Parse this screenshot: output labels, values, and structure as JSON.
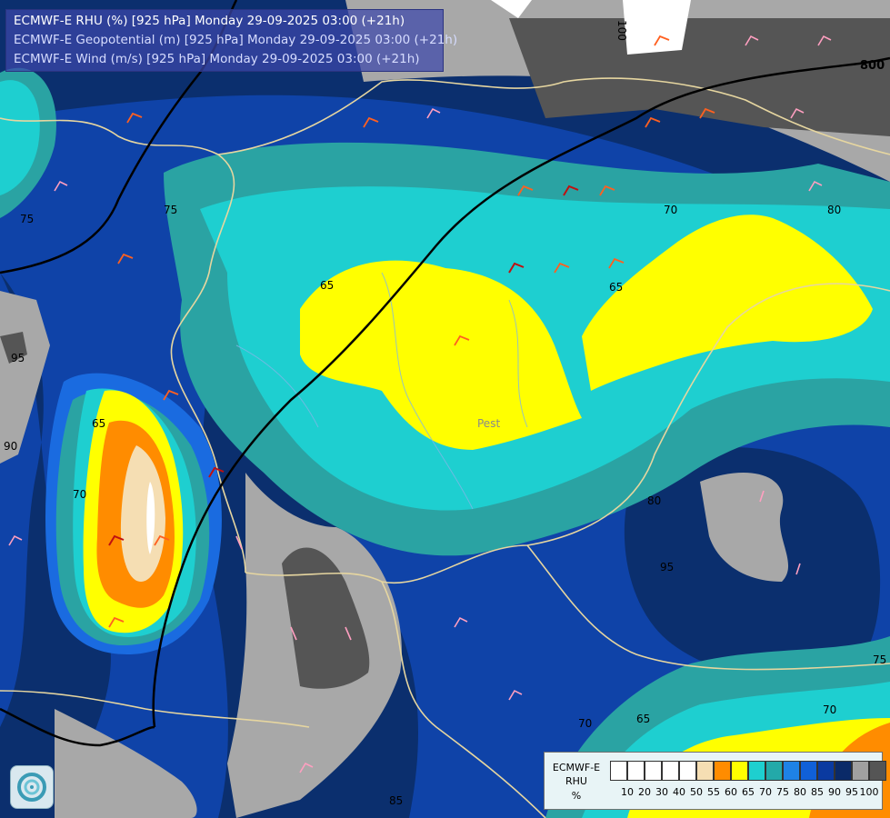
{
  "header": {
    "line1": "ECMWF-E RHU (%) [925 hPa] Monday 29-09-2025 03:00 (+21h)",
    "line2": "ECMWF-E Geopotential (m) [925 hPa] Monday 29-09-2025 03:00 (+21h)",
    "line3": "ECMWF-E Wind (m/s) [925 hPa] Monday 29-09-2025 03:00 (+21h)"
  },
  "map_labels": {
    "city_pest": "Pest",
    "contour_800": "800",
    "contour_100": "100"
  },
  "contour_labels": [
    "75",
    "75",
    "65",
    "65",
    "65",
    "70",
    "70",
    "70",
    "80",
    "80",
    "95",
    "95",
    "75",
    "65",
    "70",
    "85",
    "90"
  ],
  "legend": {
    "title1": "ECMWF-E",
    "title2": "RHU",
    "title3": "%",
    "ticks": [
      "10",
      "20",
      "30",
      "40",
      "50",
      "55",
      "60",
      "65",
      "70",
      "75",
      "80",
      "85",
      "90",
      "95",
      "100"
    ],
    "colors": [
      "#ffffff",
      "#ffffff",
      "#ffffff",
      "#ffffff",
      "#ffffff",
      "#f5deb3",
      "#ff8c00",
      "#ffff00",
      "#1ecfcf",
      "#23a9a9",
      "#1e82e6",
      "#1060d8",
      "#0a3aa0",
      "#0a2a68",
      "#a0a0a0",
      "#555555"
    ]
  },
  "palette": {
    "rh95": "#a8a8a8",
    "rh100": "#555555",
    "rh90": "#0b2f6e",
    "rh85": "#0f43a8",
    "rh80": "#1a6be0",
    "rh75": "#2aa3a3",
    "rh70": "#1ecfd0",
    "rh65": "#ffff00",
    "rh60": "#ff8c00",
    "rh55": "#f5deb3",
    "border": "#e6d6a0",
    "river": "#7fb6e6",
    "isoline": "#000000"
  },
  "icons": {
    "logo": "ecmwf-swirl-icon"
  }
}
